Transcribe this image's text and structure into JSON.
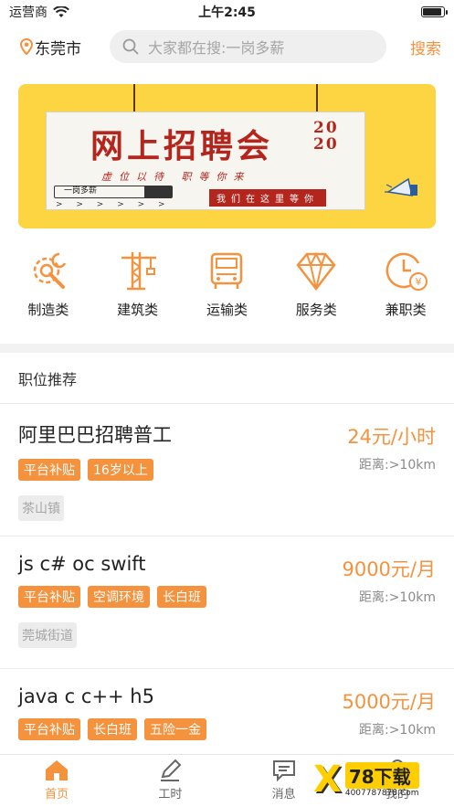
{
  "status_bar": {
    "carrier": "运营商",
    "time": "上午2:45",
    "battery_level": 0.9
  },
  "header": {
    "location": "东莞市",
    "search_placeholder": "大家都在搜:一岗多薪",
    "search_button": "搜索"
  },
  "banner": {
    "title": "网上招聘会",
    "year_top": "20",
    "year_bottom": "20",
    "subtitle": "虚位以待 职等你来",
    "tagline": "我们在这里等你",
    "search_text": "一岗多薪",
    "arrows": "> > > > > >"
  },
  "categories": [
    {
      "label": "制造类",
      "icon": "gear-wrench-icon"
    },
    {
      "label": "建筑类",
      "icon": "crane-icon"
    },
    {
      "label": "运输类",
      "icon": "truck-icon"
    },
    {
      "label": "服务类",
      "icon": "diamond-icon"
    },
    {
      "label": "兼职类",
      "icon": "clock-yen-icon"
    }
  ],
  "section": {
    "title": "职位推荐"
  },
  "jobs": [
    {
      "title": "阿里巴巴招聘普工",
      "salary": "24元/小时",
      "distance": "距离:>10km",
      "tags": [
        "平台补贴",
        "16岁以上"
      ],
      "area": "茶山镇"
    },
    {
      "title": "js  c#  oc  swift",
      "salary": "9000元/月",
      "distance": "距离:>10km",
      "tags": [
        "平台补贴",
        "空调环境",
        "长白班"
      ],
      "area": "莞城街道"
    },
    {
      "title": "java  c  c++   h5",
      "salary": "5000元/月",
      "distance": "距离:>10km",
      "tags": [
        "平台补贴",
        "长白班",
        "五险一金"
      ],
      "area": ""
    }
  ],
  "tabbar": [
    {
      "label": "首页",
      "icon": "home-icon",
      "active": true
    },
    {
      "label": "工时",
      "icon": "edit-icon",
      "active": false
    },
    {
      "label": "消息",
      "icon": "message-icon",
      "active": false
    },
    {
      "label": "我的",
      "icon": "user-icon",
      "active": false
    }
  ],
  "watermark": {
    "mark": "X",
    "brand": "78下载",
    "url": "4007787878.Com"
  },
  "colors": {
    "accent": "#f5923e",
    "banner_bg": "#fdd442",
    "tag_bg": "#f5923e"
  }
}
